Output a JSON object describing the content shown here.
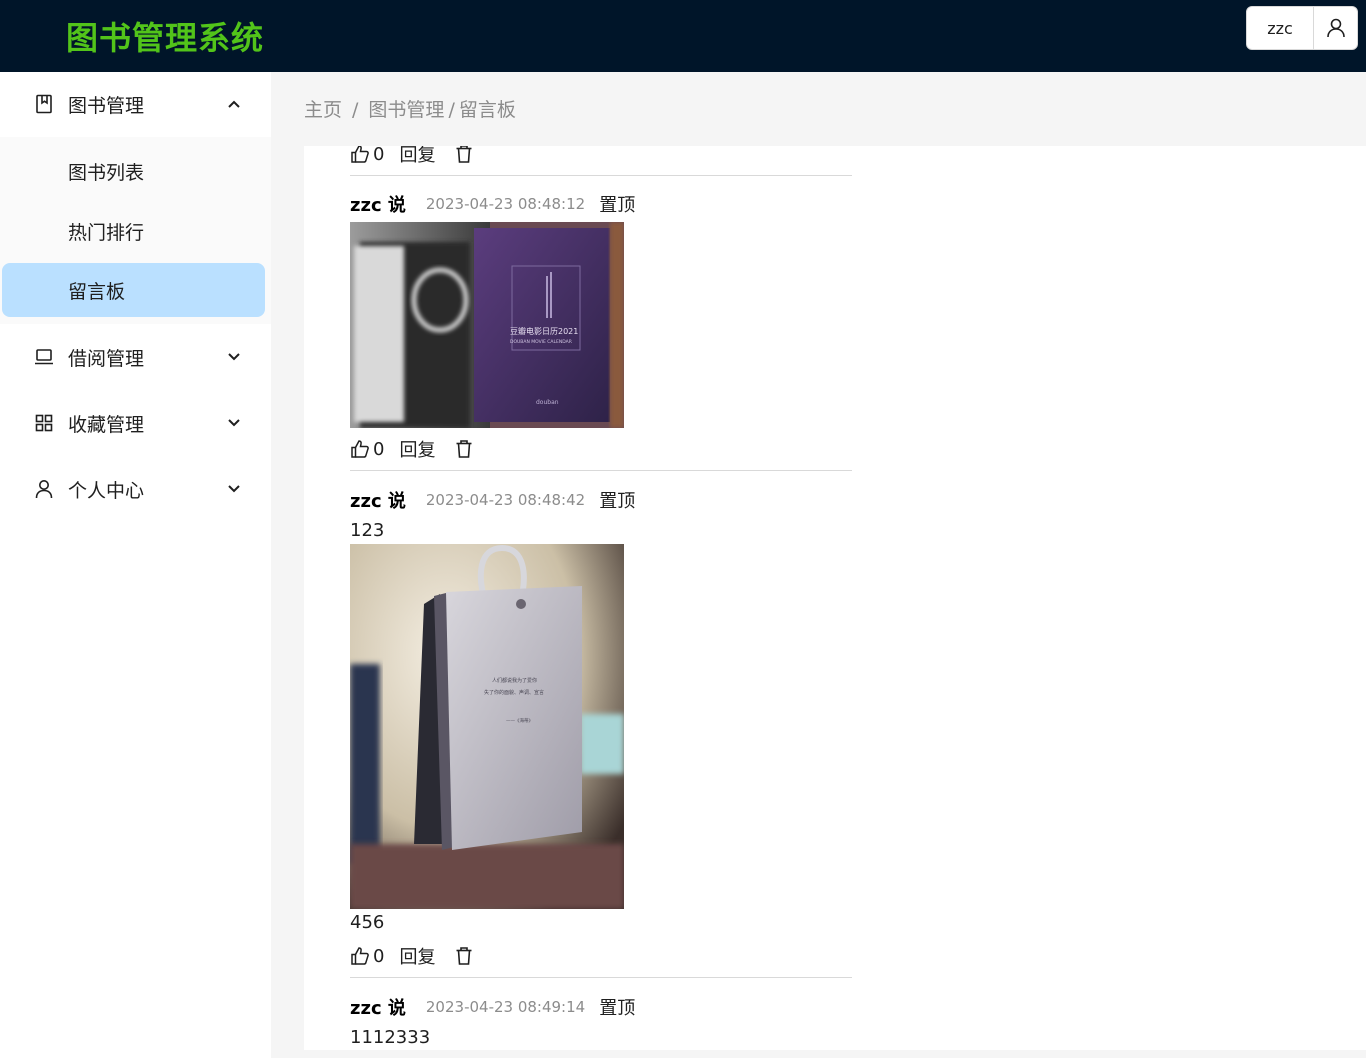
{
  "header": {
    "title": "图书管理系统",
    "username": "zzc",
    "title_color": "#52c41a",
    "bg_color": "#001529"
  },
  "sidebar": {
    "groups": [
      {
        "label": "图书管理",
        "icon": "book-icon",
        "expanded": true,
        "items": [
          {
            "label": "图书列表"
          },
          {
            "label": "热门排行"
          },
          {
            "label": "留言板",
            "active": true
          }
        ]
      },
      {
        "label": "借阅管理",
        "icon": "laptop-icon",
        "expanded": false
      },
      {
        "label": "收藏管理",
        "icon": "grid-icon",
        "expanded": false
      },
      {
        "label": "个人中心",
        "icon": "user-icon",
        "expanded": false
      }
    ],
    "active_color": "#bae0ff"
  },
  "breadcrumb": {
    "home": "主页",
    "sep": "/",
    "section": "图书管理",
    "page": "留言板"
  },
  "actions": {
    "reply": "回复",
    "pin": "置顶"
  },
  "messages": [
    {
      "likes": "0"
    },
    {
      "author": "zzc 说",
      "time": "2023-04-23 08:48:12",
      "image": "purple-calendar-box-photo",
      "likes": "0"
    },
    {
      "author": "zzc 说",
      "time": "2023-04-23 08:48:42",
      "text_before": "123",
      "image": "white-desk-calendar-photo",
      "text_after": "456",
      "likes": "0"
    },
    {
      "author": "zzc 说",
      "time": "2023-04-23 08:49:14",
      "text_before": "1112333"
    }
  ]
}
